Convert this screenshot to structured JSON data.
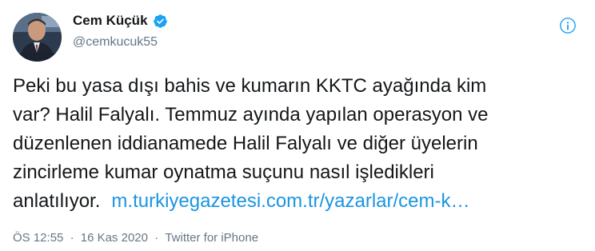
{
  "author": {
    "display_name": "Cem Küçük",
    "handle": "@cemkucuk55",
    "verified": true
  },
  "tweet": {
    "lines": [
      "Peki bu yasa dışı bahis ve kumarın KKTC ayağında kim",
      "var? Halil Falyalı. Temmuz ayında yapılan operasyon ve",
      "düzenlenen iddianamede Halil Falyalı ve diğer üyelerin",
      "zincirleme kumar oynatma suçunu nasıl işledikleri"
    ],
    "last_line_text": "anlatılıyor.",
    "link_text": "m.turkiyegazetesi.com.tr/yazarlar/cem-k…"
  },
  "meta": {
    "time": "ÖS 12:55",
    "separator": "·",
    "date": "16 Kas 2020",
    "source": "Twitter for iPhone"
  },
  "colors": {
    "link": "#1b95e0",
    "secondary_text": "#657786",
    "primary_text": "#14171a",
    "verified": "#1da1f2"
  },
  "icons": {
    "verified": "verified-badge-icon",
    "more": "more-options-icon"
  }
}
